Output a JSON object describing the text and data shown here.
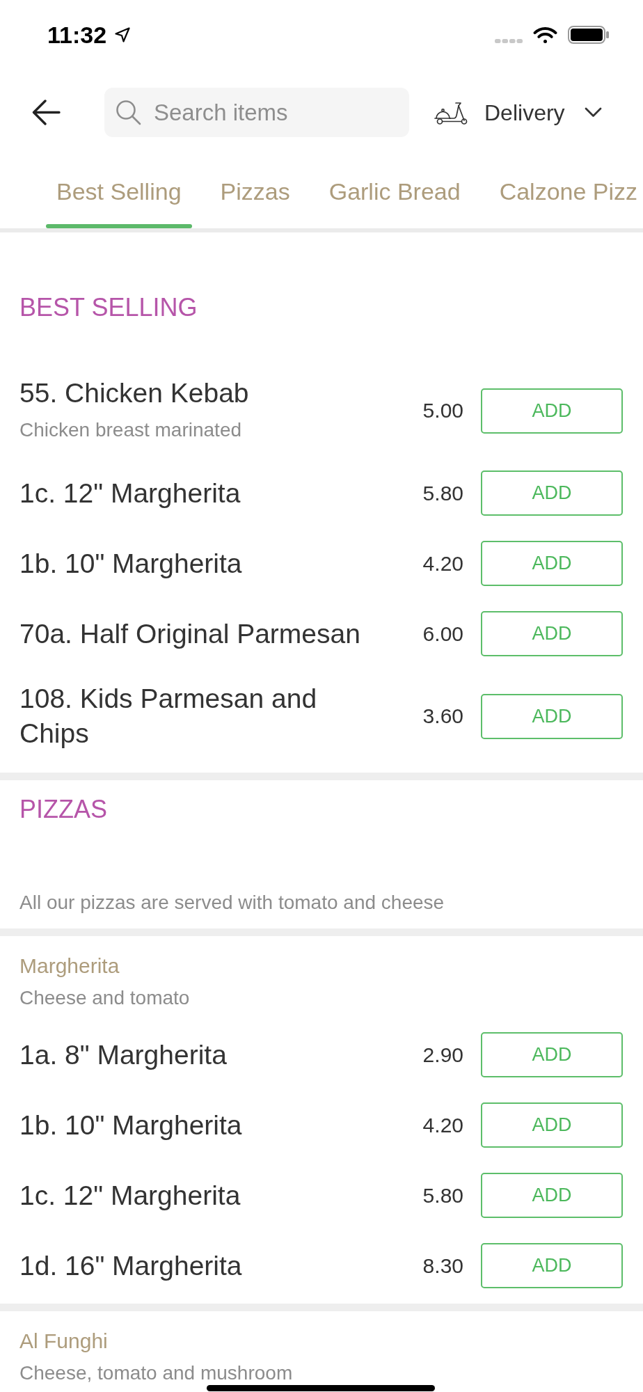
{
  "status_bar": {
    "time": "11:32"
  },
  "header": {
    "search": {
      "placeholder": "Search items"
    },
    "order_mode": {
      "label": "Delivery"
    }
  },
  "tabs": [
    {
      "label": "Best Selling",
      "selected": true
    },
    {
      "label": "Pizzas",
      "selected": false
    },
    {
      "label": "Garlic Bread",
      "selected": false
    },
    {
      "label": "Calzone Pizz",
      "selected": false
    }
  ],
  "sections": [
    {
      "title": "BEST SELLING",
      "items": [
        {
          "name": "55. Chicken Kebab",
          "description": "Chicken breast marinated",
          "price": "5.00",
          "button": "ADD"
        },
        {
          "name": "1c. 12\" Margherita",
          "price": "5.80",
          "button": "ADD"
        },
        {
          "name": "1b. 10\" Margherita",
          "price": "4.20",
          "button": "ADD"
        },
        {
          "name": "70a. Half Original Parmesan",
          "price": "6.00",
          "button": "ADD"
        },
        {
          "name": "108. Kids Parmesan and Chips",
          "price": "3.60",
          "button": "ADD"
        }
      ]
    },
    {
      "title": "PIZZAS",
      "note": "All our pizzas are served with tomato and cheese",
      "groups": [
        {
          "name": "Margherita",
          "description": "Cheese and tomato",
          "items": [
            {
              "name": "1a. 8\" Margherita",
              "price": "2.90",
              "button": "ADD"
            },
            {
              "name": "1b. 10\" Margherita",
              "price": "4.20",
              "button": "ADD"
            },
            {
              "name": "1c. 12\" Margherita",
              "price": "5.80",
              "button": "ADD"
            },
            {
              "name": "1d. 16\" Margherita",
              "price": "8.30",
              "button": "ADD"
            }
          ]
        },
        {
          "name": "Al Funghi",
          "description": "Cheese, tomato and mushroom"
        }
      ]
    }
  ]
}
